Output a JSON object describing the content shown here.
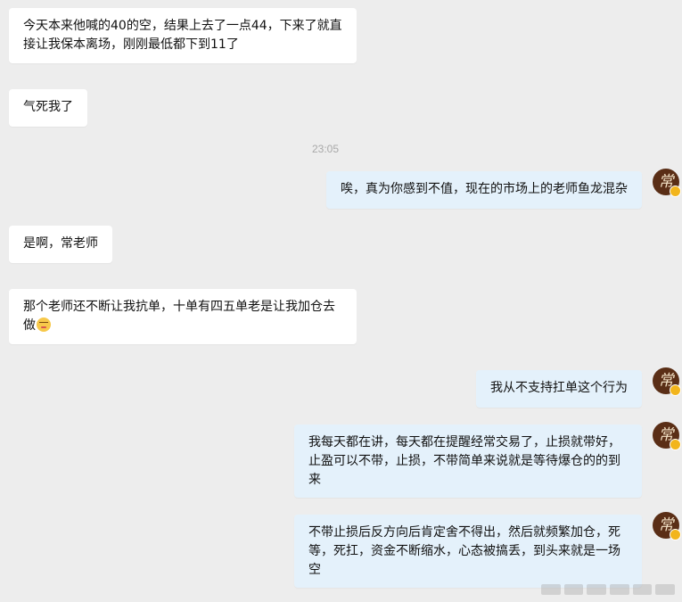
{
  "messages": [
    {
      "text": "今天本来他喊的40的空，结果上去了一点44，下来了就直接让我保本离场，刚刚最低都下到11了"
    },
    {
      "text": "气死我了"
    },
    {
      "text": "唉，真为你感到不值，现在的市场上的老师鱼龙混杂"
    },
    {
      "text": "是啊，常老师"
    },
    {
      "text": "那个老师还不断让我抗单，十单有四五单老是让我加仓去做"
    },
    {
      "text": "我从不支持扛单这个行为"
    },
    {
      "text": "我每天都在讲，每天都在提醒经常交易了，止损就带好，止盈可以不带，止损，不带简单来说就是等待爆仓的的到来"
    },
    {
      "text": "不带止损后反方向后肯定舍不得出，然后就频繁加仓，死等，死扛，资金不断缩水，心态被搞丢，到头来就是一场空"
    }
  ],
  "timestamp": "23:05",
  "avatar": {
    "glyph": "常",
    "icon": "teacher-avatar"
  },
  "colors": {
    "background": "#ededed",
    "incoming_bubble": "#ffffff",
    "outgoing_bubble": "#e4f1fb"
  }
}
